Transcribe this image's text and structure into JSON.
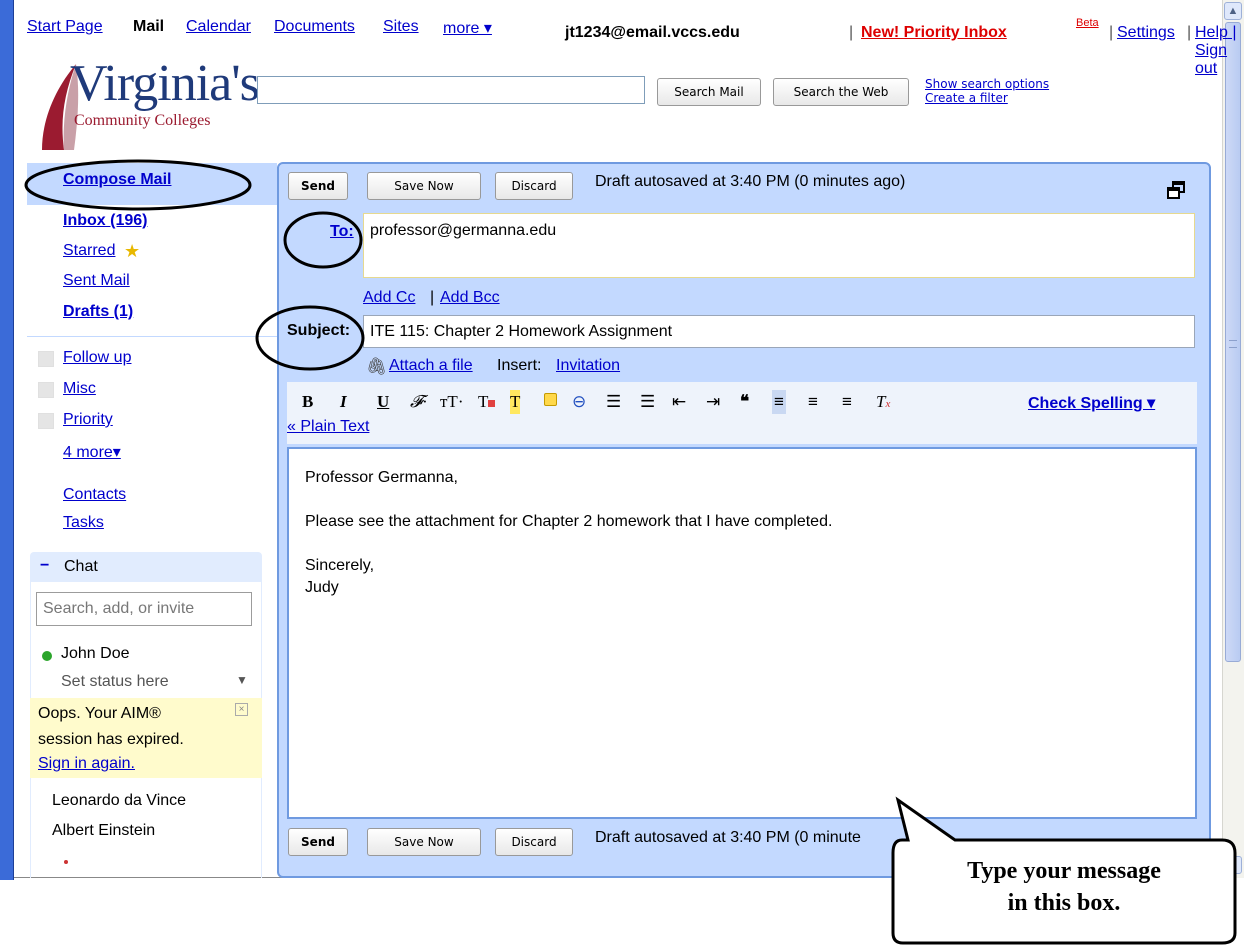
{
  "nav": {
    "start_page": "Start Page",
    "mail": "Mail",
    "calendar": "Calendar",
    "documents": "Documents",
    "sites": "Sites",
    "more": "more ▾"
  },
  "account": {
    "email": "jt1234@email.vccs.edu",
    "sep": "|",
    "priority_inbox": "New! Priority Inbox",
    "beta": "Beta",
    "settings": "Settings",
    "help": "Help",
    "sign_out": "Sign out"
  },
  "logo": {
    "word": "Virginia's",
    "sub": "Community Colleges"
  },
  "search": {
    "value": "",
    "search_mail": "Search Mail",
    "search_web": "Search the Web",
    "show_options": "Show search options",
    "create_filter": "Create a filter"
  },
  "sidebar": {
    "compose": "Compose Mail",
    "inbox": "Inbox (196)",
    "starred": "Starred",
    "sent": "Sent Mail",
    "drafts": "Drafts (1)",
    "labels": [
      "Follow up",
      "Misc",
      "Priority"
    ],
    "more_labels": "4 more▾",
    "contacts": "Contacts",
    "tasks": "Tasks"
  },
  "chat": {
    "minus": "−",
    "title": "Chat",
    "search_placeholder": "Search, add, or invite",
    "me": "John Doe",
    "status": "Set status here",
    "aim_msg_1": "Oops. Your AIM®",
    "aim_msg_2": "session has expired.",
    "aim_signin": "Sign in again.",
    "contacts": [
      "Leonardo da Vince",
      "Albert Einstein"
    ]
  },
  "compose": {
    "send": "Send",
    "save_now": "Save Now",
    "discard": "Discard",
    "autosave": "Draft autosaved at 3:40 PM (0 minutes ago)",
    "autosave_bottom": "Draft autosaved at 3:40 PM (0 minute",
    "to_label": "To:",
    "to_value": "professor@germanna.edu",
    "add_cc": "Add Cc",
    "cc_sep": "|",
    "add_bcc": "Add Bcc",
    "subject_label": "Subject:",
    "subject_value": "ITE 115: Chapter 2 Homework Assignment",
    "attach": "Attach a file",
    "insert": "Insert:",
    "invitation": "Invitation",
    "check_spelling": "Check Spelling ▾",
    "plain_text": "« Plain Text",
    "body_greeting": "Professor Germanna,",
    "body_line": "Please see the attachment for Chapter 2 homework that I have completed.",
    "body_closing": "Sincerely,",
    "body_name": "Judy"
  },
  "callout": {
    "line1": "Type your message",
    "line2": "in this box."
  },
  "colors": {
    "accent": "#c3d9ff",
    "border": "#6f9ae0",
    "link": "#0000cc",
    "priority": "#dd0000",
    "presence": "#2ba52b"
  }
}
